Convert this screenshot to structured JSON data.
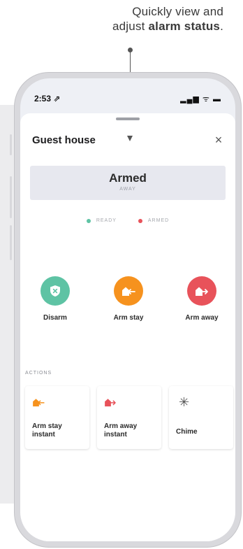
{
  "caption": {
    "line1": "Quickly view and",
    "line2_prefix": "adjust ",
    "line2_bold": "alarm status",
    "line2_suffix": "."
  },
  "status_bar": {
    "time": "2:53 ⇗",
    "icons": "▂▄▆ ᯤ ▬"
  },
  "sheet": {
    "title": "Guest house",
    "close_glyph": "×"
  },
  "status": {
    "main": "Armed",
    "sub": "AWAY"
  },
  "legend": [
    {
      "label": "READY",
      "color": "#5ec3a4"
    },
    {
      "label": "ARMED",
      "color": "#e8525a"
    }
  ],
  "arm_buttons": [
    {
      "label": "Disarm",
      "color": "#5ec3a4",
      "icon": "shield-icon"
    },
    {
      "label": "Arm stay",
      "color": "#f6921e",
      "icon": "house-arrow-in-icon"
    },
    {
      "label": "Arm away",
      "color": "#e8525a",
      "icon": "house-arrow-out-icon"
    }
  ],
  "actions": {
    "title": "ACTIONS",
    "items": [
      {
        "label": "Arm stay\ninstant",
        "icon": "house-arrow-in-icon",
        "color": "#f6921e"
      },
      {
        "label": "Arm away\ninstant",
        "icon": "house-arrow-out-icon",
        "color": "#e8525a"
      },
      {
        "label": "Chime",
        "icon": "asterisk-icon",
        "glyph": "✳"
      }
    ]
  }
}
